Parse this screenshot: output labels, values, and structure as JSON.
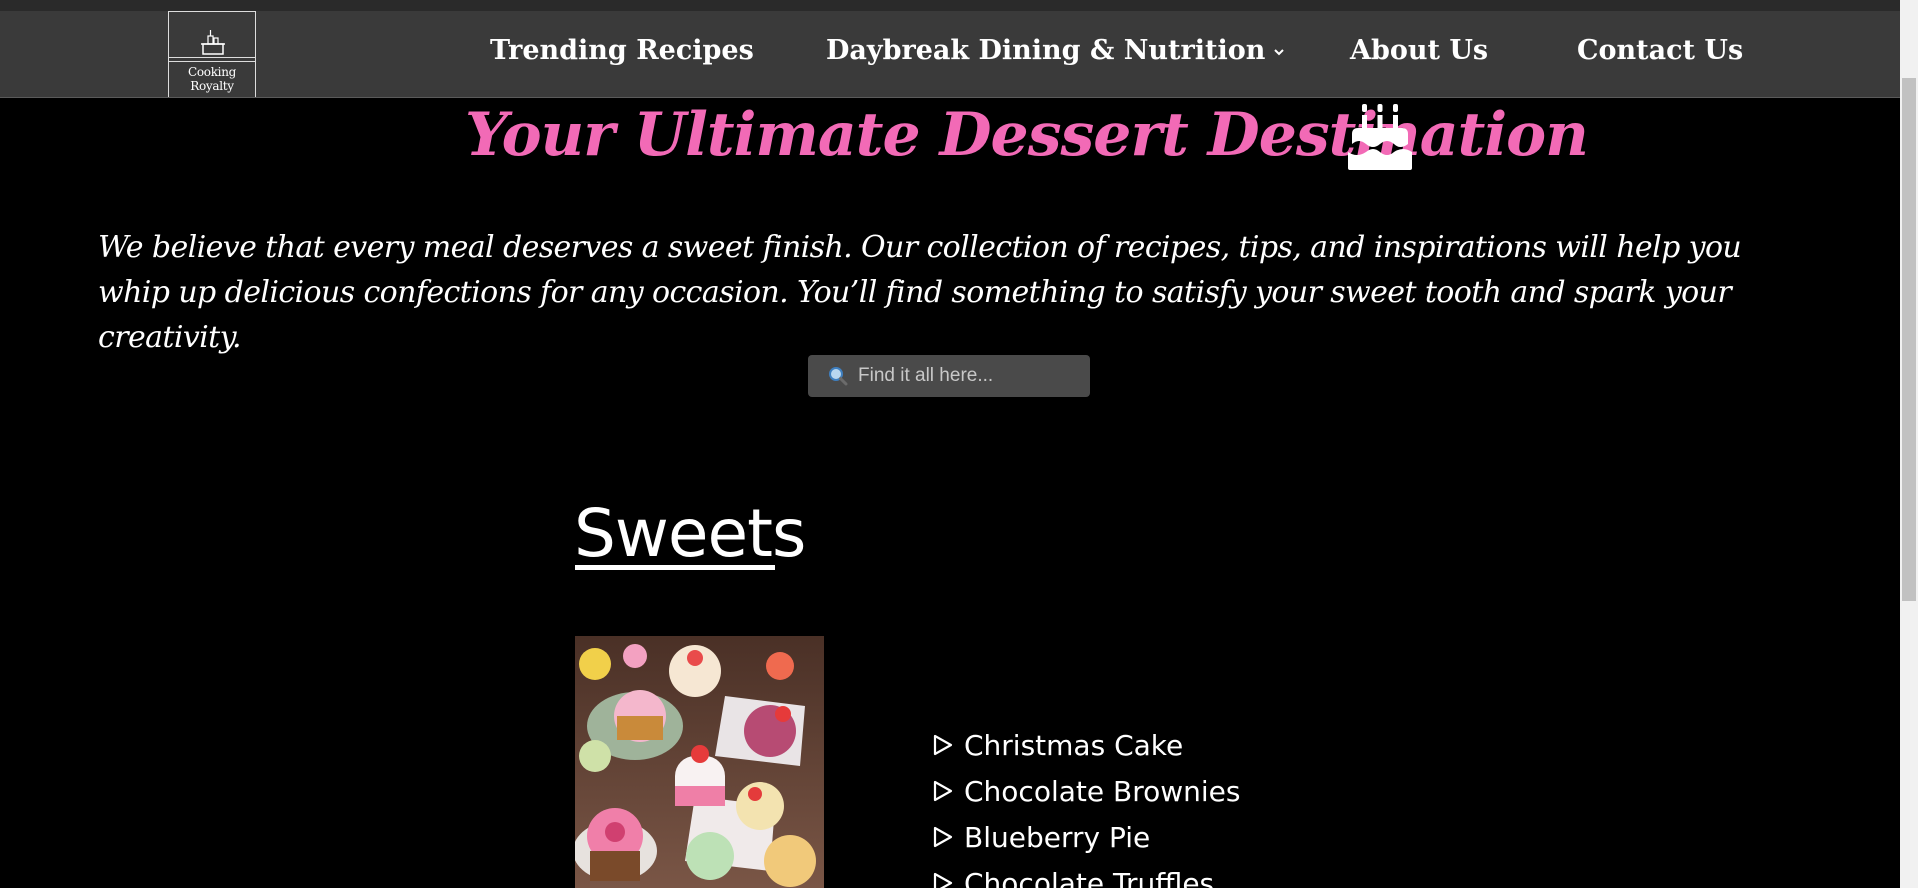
{
  "logo": {
    "text": "Cooking Royalty"
  },
  "nav": {
    "items": [
      {
        "label": "Trending Recipes"
      },
      {
        "label": "Daybreak Dining & Nutrition",
        "has_dropdown": true
      },
      {
        "label": "About Us"
      },
      {
        "label": "Contact Us"
      }
    ]
  },
  "hero": {
    "title": "Your Ultimate Dessert Destination",
    "icon": "birthday-cake-icon",
    "intro": "We believe that every meal deserves a sweet finish. Our collection of recipes, tips, and inspirations will help you whip up delicious confections for any occasion. You’ll find something to satisfy your sweet tooth and spark your creativity."
  },
  "search": {
    "placeholder": "Find it all here...",
    "value": ""
  },
  "section": {
    "title": "Sweets",
    "recipes": [
      "Christmas Cake",
      "Chocolate Brownies",
      "Blueberry Pie",
      "Chocolate Truffles"
    ]
  },
  "colors": {
    "accent_pink": "#f26ab6",
    "navbar_bg": "#3a3a3a",
    "page_bg": "#000000",
    "search_bg": "#4a4a4a"
  }
}
